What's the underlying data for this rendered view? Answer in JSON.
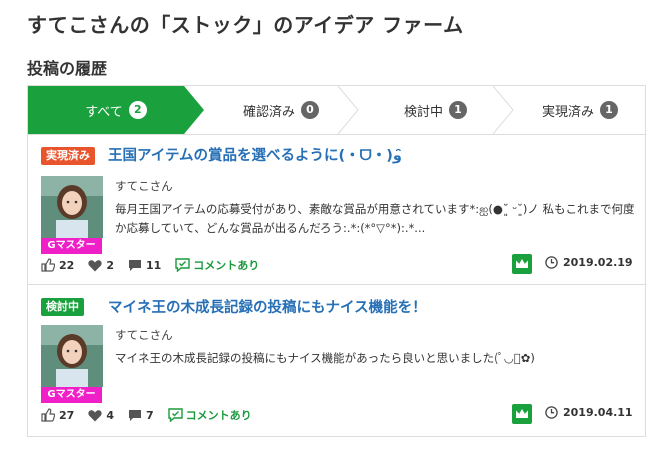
{
  "header": {
    "title": "すてこさんの「ストック」のアイデア ファーム",
    "section": "投稿の履歴"
  },
  "tabs": [
    {
      "label": "すべて",
      "count": "2",
      "active": true
    },
    {
      "label": "確認済み",
      "count": "0",
      "active": false
    },
    {
      "label": "検討中",
      "count": "1",
      "active": false
    },
    {
      "label": "実現済み",
      "count": "1",
      "active": false
    }
  ],
  "colors": {
    "accent_green": "#1aa03c",
    "link_blue": "#2770b6",
    "badge_realized": "#e8552d",
    "badge_considering": "#1aa03c",
    "rank_magenta": "#f020c8"
  },
  "posts": [
    {
      "status": "実現済み",
      "title": "王国アイテムの賞品を選べるように(・ᗜ・)و ̑̑",
      "author": "すてこさん",
      "rank": "Gマスター",
      "body": "毎月王国アイテムの応募受付があり、素敵な賞品が用意されています*:ஐ(●˘͈ ᵕ˘͈)ノ 私もこれまで何度か応募していて、どんな賞品が出るんだろう:.*:(*°▽°*):.*...",
      "likes": "22",
      "hearts": "2",
      "comments": "11",
      "comment_label": "コメントあり",
      "date": "2019.02.19",
      "icons": [
        "thumbs-up-icon",
        "heart-icon",
        "comment-icon",
        "comment-exists-icon",
        "crown-icon",
        "clock-icon"
      ]
    },
    {
      "status": "検討中",
      "title": "マイネ王の木成長記録の投稿にもナイス機能を！",
      "author": "すてこさん",
      "rank": "Gマスター",
      "body": "マイネ王の木成長記録の投稿にもナイス機能があったら良いと思いました(ﾟ◡ﾟ✿)",
      "likes": "27",
      "hearts": "4",
      "comments": "7",
      "comment_label": "コメントあり",
      "date": "2019.04.11",
      "icons": [
        "thumbs-up-icon",
        "heart-icon",
        "comment-icon",
        "comment-exists-icon",
        "crown-icon",
        "clock-icon"
      ]
    }
  ]
}
